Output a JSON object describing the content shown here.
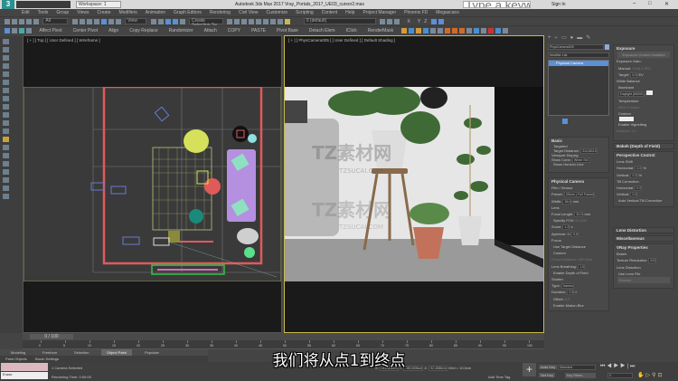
{
  "titlebar": {
    "logo": "3",
    "workspace": "Workspace: 1",
    "title": "Autodesk 3ds Max 2017   Vray_Portals_2017_UE03_cursor2.max",
    "search_placeholder": "Type a keyword or phrase",
    "signin": "Sign In"
  },
  "menu": [
    "Edit",
    "Tools",
    "Group",
    "Views",
    "Create",
    "Modifiers",
    "Animation",
    "Graph Editors",
    "Rendering",
    "Civil View",
    "Customize",
    "Scripting",
    "Content",
    "Help",
    "Project Manager",
    "Phoenix FD",
    "Megascans"
  ],
  "toolbar1": {
    "filter": "All",
    "view": "View",
    "selection_set": "Create Selection Se",
    "layer": "0 (default)",
    "axes": [
      "X",
      "Y",
      "Z"
    ]
  },
  "toolbar2": [
    "Affect Pivot",
    "Center Pivot",
    "Align",
    "Copy Replace",
    "Randomizer",
    "Attach",
    "COPY",
    "PASTE",
    "Pivot Base",
    "Detach Elem",
    "IClick",
    "RenderMask"
  ],
  "viewports": {
    "left_label": "[ + ] [ Top ] [ User Defined ] [ Wireframe ]",
    "right_label": "[ + ] [ PhysCamera005 ] [ User Defined ] [ Default Shading ]"
  },
  "watermark": {
    "cn": "TZ素材网",
    "url": "TZSUCAI.COM"
  },
  "command_panel": {
    "object_name": "PhysCamera005",
    "modifier_list": "Modifier List",
    "stack_item": "Physical Camera",
    "basic": {
      "title": "Basic",
      "targeted": "Targeted",
      "target_distance_label": "Target Distance:",
      "target_distance": "314,804.0",
      "viewport_display": "Viewport Display",
      "show_cone_label": "Show Cone:",
      "show_cone": "When Sel.",
      "show_horizon": "Show Horizon Line"
    },
    "physical": {
      "title": "Physical Camera",
      "film": "Film / Sensor",
      "preset_label": "Preset:",
      "preset": "35mm ( Full Frame)",
      "width_label": "Width:",
      "width": "36,0",
      "width_unit": "mm",
      "lens": "Lens",
      "focal_label": "Focal Length:",
      "focal": "30,0",
      "focal_unit": "mm",
      "fov": "Specify FOV:",
      "fov_val": "61,928",
      "zoom_label": "Zoom:",
      "zoom": "1,0",
      "zoom_unit": "x",
      "aperture_label": "Aperture:",
      "aperture_prefix": "f /",
      "aperture": "5,6",
      "focus": "Focus",
      "use_target": "Use Target Distance",
      "custom": "Custom",
      "focus_dist_label": "Focus Distance:",
      "focus_dist": "300,0cm",
      "breathing_label": "Lens Breathing:",
      "breathing": "1,0",
      "dof": "Enable Depth of Field",
      "shutter": "Shutter",
      "type_label": "Type:",
      "type": "frames",
      "duration_label": "Duration:",
      "duration": "0,5",
      "duration_unit": "f",
      "offset_label": "Offset:",
      "offset": "0,0",
      "motion_blur": "Enable Motion Blur"
    },
    "exposure": {
      "title": "Exposure",
      "control": "Exposure Control Installed",
      "gain": "Exposure Gain:",
      "manual": "Manual:",
      "manual_val": "2048,0 ISO",
      "target": "Target:",
      "target_val": "6,0",
      "target_unit": "EV",
      "wb": "White Balance",
      "illuminant": "Illuminant",
      "illuminant_val": "Daylight (6500K)",
      "temperature": "Temperature",
      "temp_val": "6500,0",
      "temp_unit": "kelvin",
      "custom": "Custom",
      "vignetting": "Enable Vignetting",
      "amount_label": "Amount:",
      "amount": "1,0"
    },
    "bokeh": "Bokeh (Depth of Field)",
    "perspective": {
      "title": "Perspective Control",
      "lens_shift": "Lens Shift",
      "horizontal": "Horizontal:",
      "h_val": "0,0",
      "vertical": "Vertical:",
      "v_val": "0,0",
      "pct": "%",
      "tilt": "Tilt Correction",
      "th_val": "0,0",
      "tv_val": "0,0",
      "auto_tilt": "Auto Vertical Tilt Correction"
    },
    "lens_distortion": "Lens Distortion",
    "misc": "Miscellaneous",
    "vray": {
      "title": "VRay Properties",
      "bokeh": "Bokeh",
      "texres_label": "Texture Resolution:",
      "texres": "512",
      "lens_dist": "Lens Distortion",
      "use_lens_file": "Use Lens File",
      "browse": "Browse"
    }
  },
  "timeline": {
    "frame": "0 / 100",
    "ticks": [
      "0",
      "5",
      "10",
      "15",
      "20",
      "25",
      "30",
      "35",
      "40",
      "45",
      "50",
      "55",
      "60",
      "65",
      "70",
      "75",
      "80",
      "85",
      "90",
      "95",
      "100"
    ]
  },
  "ribbon_tabs": [
    "Modeling",
    "Freeform",
    "Selection",
    "Object Paint",
    "Populate"
  ],
  "ribbon_sub": [
    "Paint Objects",
    "Brush Settings"
  ],
  "status": {
    "maxscript": "Erase",
    "selected": "1 Camera Selected",
    "render_time": "Rendering Time: 0:00:00",
    "x": "115,5080m",
    "y": "-98,0496cm",
    "z": "92,4586cm",
    "grid": "Grid = 10,0cm",
    "add_time_tag": "Add Time Tag",
    "auto_key": "Auto Key",
    "set_key": "Set Key",
    "selected_dd": "Selected",
    "key_filters": "Key Filters...",
    "frame_field": "0"
  },
  "subtitle": "我们将从点1到终点",
  "colors": {
    "bg": "#444444",
    "viewport": "#1a1a1a",
    "accent": "#5b8fd6",
    "wire_red": "#e05a5a"
  }
}
